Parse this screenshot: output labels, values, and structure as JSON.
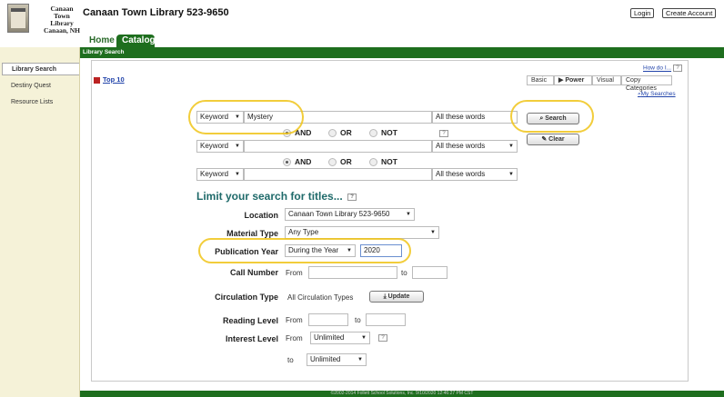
{
  "header": {
    "logo_text": "Canaan\nTown\nLibrary\nCanaan, NH",
    "site_title": "Canaan Town Library 523-9650",
    "login": "Login",
    "create_account": "Create Account"
  },
  "nav": {
    "tabs": [
      "Home",
      "Catalog"
    ],
    "subtitle": "Library Search"
  },
  "sidebar": {
    "items": [
      "Library Search",
      "Destiny Quest",
      "Resource Lists"
    ]
  },
  "main": {
    "top10": "Top 10",
    "how_do_i": "How do I...",
    "help": "?",
    "mode_tabs": [
      "Basic",
      "Power",
      "Visual",
      "Copy Categories"
    ],
    "my_searches": "My Searches"
  },
  "search": {
    "row1": {
      "type": "Keyword",
      "value": "Mystery",
      "match": "All these words"
    },
    "row2": {
      "type": "Keyword",
      "value": "",
      "match": "All these words"
    },
    "row3": {
      "type": "Keyword",
      "value": "",
      "match": "All these words"
    },
    "bool": [
      "AND",
      "OR",
      "NOT"
    ],
    "search_btn": "Search",
    "clear_btn": "Clear"
  },
  "limits": {
    "title": "Limit your search for titles...",
    "location_label": "Location",
    "location_value": "Canaan Town Library 523-9650",
    "material_label": "Material Type",
    "material_value": "Any Type",
    "pubyear_label": "Publication Year",
    "pubyear_mode": "During the Year",
    "pubyear_value": "2020",
    "callnum_label": "Call Number",
    "from": "From",
    "to": "to",
    "circ_label": "Circulation Type",
    "circ_value": "All Circulation Types",
    "update_btn": "Update",
    "reading_label": "Reading Level",
    "interest_label": "Interest Level",
    "unlimited": "Unlimited"
  },
  "footer": {
    "text": "©2002-2014 Follett School Solutions, Inc. 9/10/2020 12:46:27 PM CST"
  }
}
